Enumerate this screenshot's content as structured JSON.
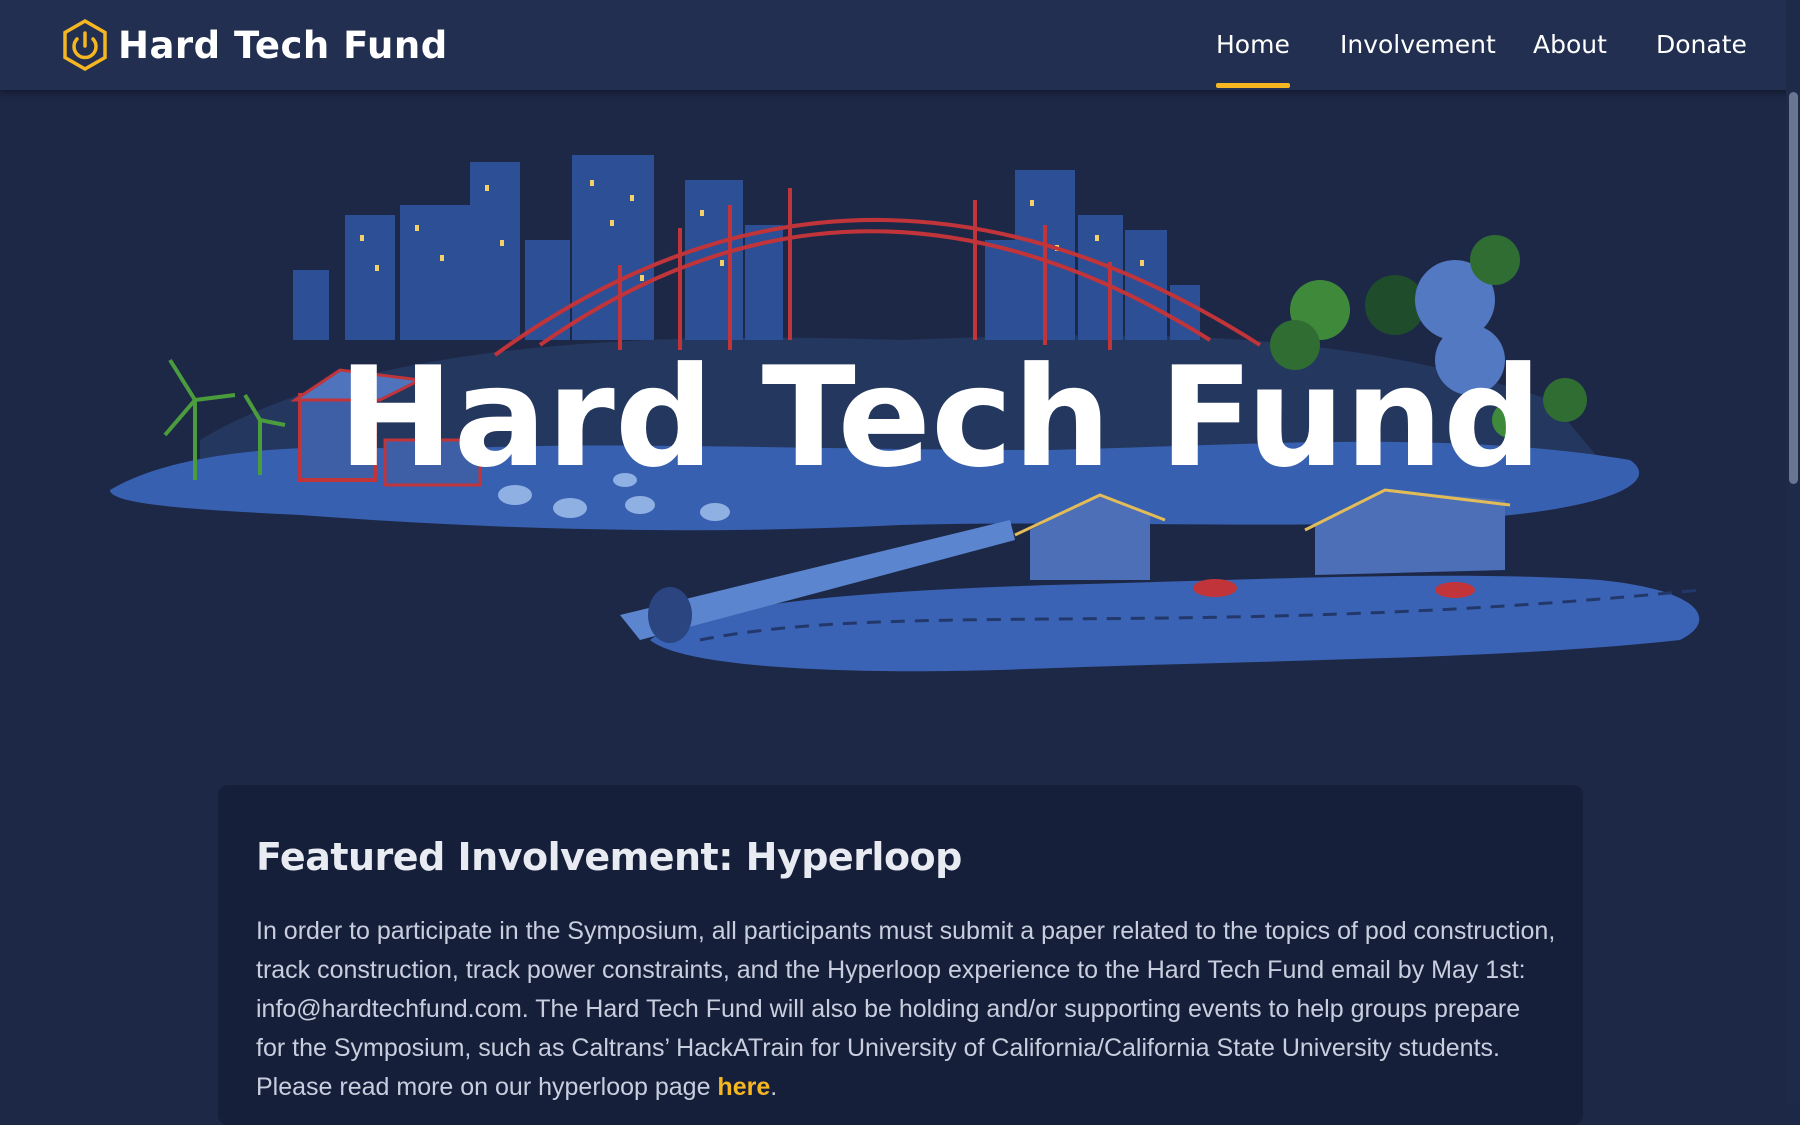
{
  "nav": {
    "brand": "Hard Tech Fund",
    "links": [
      "Home",
      "Involvement",
      "About",
      "Donate"
    ],
    "active": "Home",
    "accent": "#f5b621"
  },
  "hero": {
    "title": "Hard Tech Fund"
  },
  "featured": {
    "title": "Featured Involvement: Hyperloop",
    "body": "In order to participate in the Symposium, all participants must submit a paper related to the topics of pod construction, track construction, track power constraints, and the Hyperloop experience to the Hard Tech Fund email by May 1st: info@hardtechfund.com. The Hard Tech Fund will also be holding and/or supporting events to help groups prepare for the Symposium, such as Caltrans’ HackATrain for University of California/California State University students. Please read more on our hyperloop page ",
    "link_text": "here",
    "body_end": "."
  },
  "colors": {
    "background": "#1d2847",
    "navbar": "#222f51",
    "card": "#161f3a",
    "bridge": "#c0343a"
  }
}
